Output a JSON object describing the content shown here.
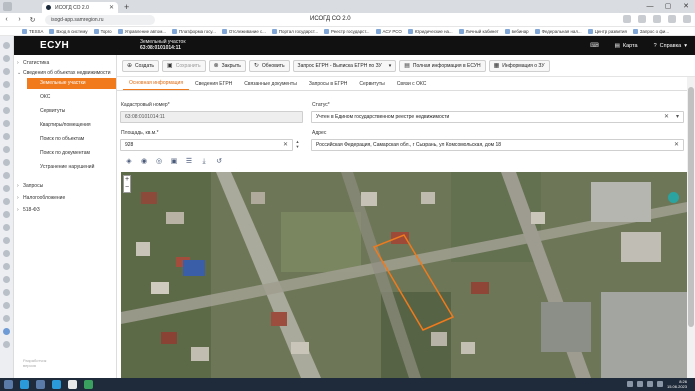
{
  "browser": {
    "tab_title": "ИСОГД СО 2.0",
    "url": "isogd-app.samregion.ru",
    "page_title": "ИСОГД СО 2.0",
    "bookmarks": [
      "TESSA",
      "Вход в систему",
      "Topro",
      "Управление автом...",
      "Платформа госу...",
      "Отслеживание с...",
      "Портал государст...",
      "Реестр государст...",
      "АСУ РСО",
      "Юридические на...",
      "Личный кабинет",
      "вебинар",
      "Федеральная нал...",
      "Центр развития",
      "Запрос о фи..."
    ]
  },
  "header": {
    "logo": "ЕСУН",
    "object_type": "Земельный участок",
    "object_number": "63:08:0101014:11",
    "map_label": "Карта",
    "help_label": "Справка"
  },
  "leftnav": {
    "items": [
      {
        "label": "Статистика",
        "chev": "›"
      },
      {
        "label": "Сведения об объектах недвижимости",
        "chev": "⌄"
      }
    ],
    "subitems": [
      {
        "label": "Земельные участки",
        "active": true
      },
      {
        "label": "ОКС"
      },
      {
        "label": "Сервитуты"
      },
      {
        "label": "Квартиры/помещения"
      },
      {
        "label": "Поиск по объектам"
      },
      {
        "label": "Поиск по документам"
      },
      {
        "label": "Устранение нарушений"
      }
    ],
    "bottom_items": [
      {
        "label": "Запросы",
        "chev": "›"
      },
      {
        "label": "Налогообложение",
        "chev": "›"
      },
      {
        "label": "518-ФЗ",
        "chev": "›"
      }
    ],
    "footer": "Разработчик\nверсия"
  },
  "toolbar": {
    "create": "Создать",
    "save": "Сохранить",
    "close": "Закрыть",
    "refresh": "Обновить",
    "egrn_request": "Запрос ЕГРН - Выписка ЕГРН по ЗУ",
    "full_info": "Полная информация в ЕСУН",
    "zu_info": "Информация о ЗУ"
  },
  "tabs": [
    "Основная информация",
    "Сведения ЕГРН",
    "Связанные документы",
    "Запросы в ЕГРН",
    "Сервитуты",
    "Связи с ОКС"
  ],
  "form": {
    "cadastral_label": "Кадастровый номер*",
    "cadastral_value": "63:08:0101014:11",
    "status_label": "Статус*",
    "status_value": "Учтен в Едином государственном реестре недвижимости",
    "area_label": "Площадь, кв.м.*",
    "area_value": "928",
    "address_label": "Адрес",
    "address_value": "Российская Федерация, Самарская обл., г Сызрань, ул Комсомольская, дом 18"
  },
  "map": {
    "zoom_in": "+",
    "zoom_out": "−"
  },
  "taskbar": {
    "time": "8:26",
    "date": "15.06.2023"
  }
}
